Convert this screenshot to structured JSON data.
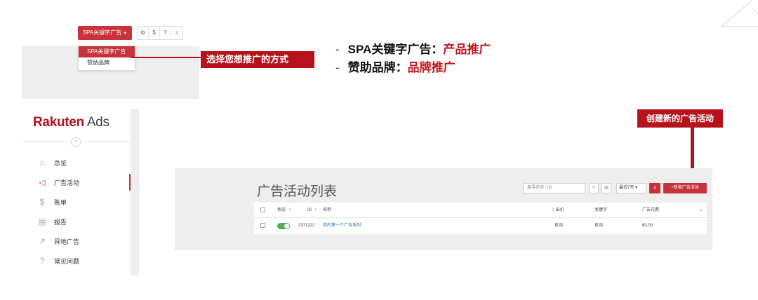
{
  "top_bar": {
    "campaign_type_button": "SPA关键字广告",
    "icons": [
      "gear-icon",
      "dollar-icon",
      "help-icon",
      "bell-icon"
    ],
    "dropdown_options": [
      "SPA关键字广告",
      "赞助品牌"
    ],
    "dropdown_selected": "SPA关键字广告"
  },
  "annotations": {
    "choose_method": "选择您想推广的方式",
    "create_campaign": "创建新的广告活动",
    "bullets": [
      {
        "prefix": "SPA关键字广告：",
        "highlight": "产品推广"
      },
      {
        "prefix": "赞助品牌：",
        "highlight": "品牌推广"
      }
    ],
    "bullet_dash": "-"
  },
  "logo": {
    "brand": "Rakuten",
    "product": "Ads"
  },
  "sidebar": {
    "items": [
      {
        "label": "总览",
        "icon": "home-icon"
      },
      {
        "label": "广告活动",
        "icon": "megaphone-icon",
        "active": true
      },
      {
        "label": "账单",
        "icon": "dollar-icon"
      },
      {
        "label": "报告",
        "icon": "report-icon"
      },
      {
        "label": "异地广告",
        "icon": "external-ad-icon"
      },
      {
        "label": "常见问题",
        "icon": "faq-icon"
      }
    ]
  },
  "campaign_list": {
    "title": "广告活动列表",
    "search_placeholder": "搜寻名称 / ID",
    "date_range": "最近7天",
    "new_campaign_button": "+新增广告活动",
    "columns": {
      "status": "状态",
      "id": "ID",
      "name": "名称",
      "bid": "出价",
      "keywords": "关键字",
      "spend": "广告花费"
    },
    "rows": [
      {
        "status_on": true,
        "id": "2371222",
        "name": "我的第一个广告系列",
        "bid": "自动",
        "keywords": "自动",
        "spend": "€0.00"
      }
    ]
  },
  "colors": {
    "accent": "#c8323a",
    "callout": "#b5121b",
    "toggle_on": "#4caf50"
  }
}
